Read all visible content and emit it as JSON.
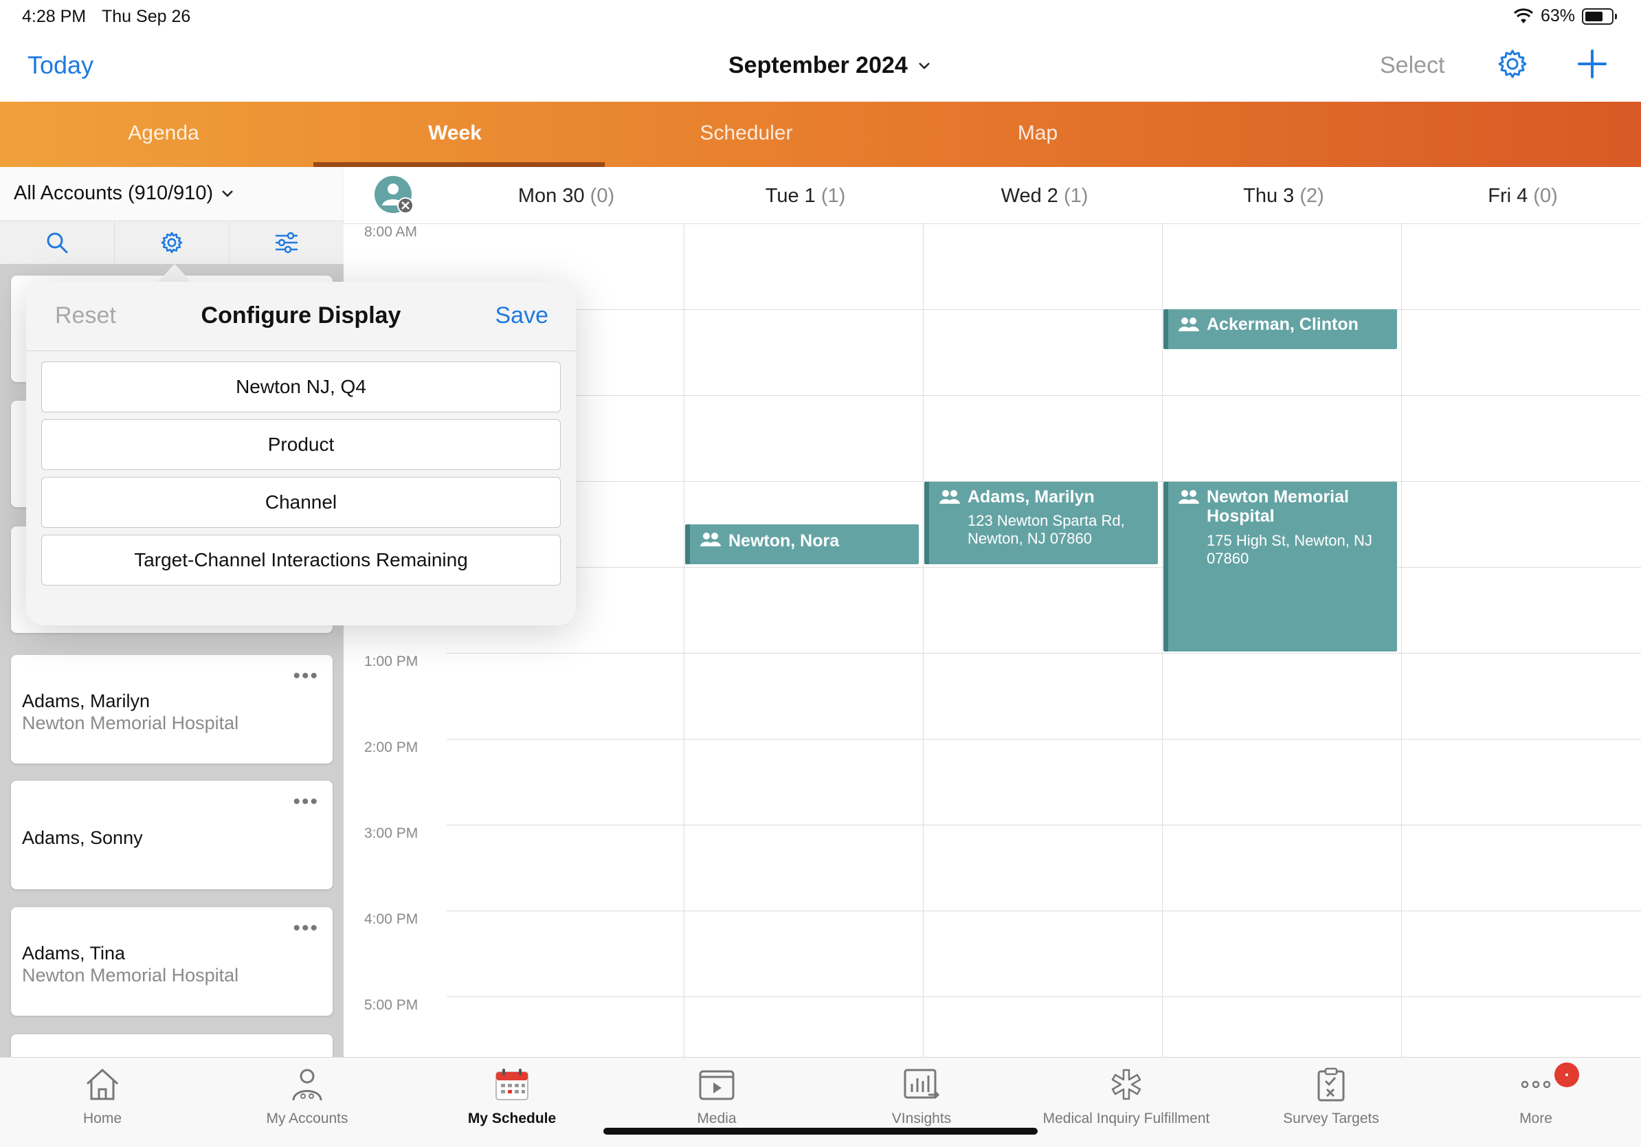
{
  "status_bar": {
    "time": "4:28 PM",
    "date": "Thu Sep 26",
    "battery": "63%"
  },
  "nav": {
    "today": "Today",
    "title": "September 2024",
    "select": "Select"
  },
  "tabs": [
    {
      "label": "Agenda"
    },
    {
      "label": "Week"
    },
    {
      "label": "Scheduler"
    },
    {
      "label": "Map"
    }
  ],
  "accounts": {
    "header": "All Accounts (910/910)",
    "cards": [
      {
        "name": "Adams, Marilyn",
        "sub": "Newton Memorial Hospital"
      },
      {
        "name": "Adams, Sonny",
        "sub": ""
      },
      {
        "name": "Adams, Tina",
        "sub": "Newton Memorial Hospital"
      }
    ]
  },
  "popover": {
    "reset": "Reset",
    "title": "Configure Display",
    "save": "Save",
    "items": [
      "Newton NJ, Q4",
      "Product",
      "Channel",
      "Target-Channel Interactions Remaining"
    ]
  },
  "calendar": {
    "days": [
      {
        "label": "Mon 30",
        "count": "(0)"
      },
      {
        "label": "Tue 1",
        "count": "(1)"
      },
      {
        "label": "Wed 2",
        "count": "(1)"
      },
      {
        "label": "Thu 3",
        "count": "(2)"
      },
      {
        "label": "Fri 4",
        "count": "(0)"
      }
    ],
    "times": [
      "8:00 AM",
      "1:00 PM",
      "2:00 PM",
      "3:00 PM",
      "4:00 PM",
      "5:00 PM"
    ],
    "events": [
      {
        "title": "Ackerman, Clinton",
        "address": ""
      },
      {
        "title": "Newton, Nora",
        "address": ""
      },
      {
        "title": "Adams, Marilyn",
        "address": "123 Newton Sparta Rd, Newton, NJ 07860"
      },
      {
        "title": "Newton Memorial Hospital",
        "address": "175 High St, Newton, NJ 07860"
      }
    ]
  },
  "bottom_tabs": [
    {
      "label": "Home",
      "icon": "home-icon"
    },
    {
      "label": "My Accounts",
      "icon": "accounts-icon"
    },
    {
      "label": "My Schedule",
      "icon": "calendar-icon"
    },
    {
      "label": "Media",
      "icon": "media-icon"
    },
    {
      "label": "VInsights",
      "icon": "insights-icon"
    },
    {
      "label": "Medical Inquiry Fulfillment",
      "icon": "medical-icon"
    },
    {
      "label": "Survey Targets",
      "icon": "survey-icon"
    },
    {
      "label": "More",
      "icon": "more-icon"
    }
  ],
  "colors": {
    "accent": "#1e7ae0",
    "event": "#64a3a4",
    "tab_start": "#f0a03a",
    "tab_end": "#d85a26",
    "badge": "#e23b30"
  }
}
